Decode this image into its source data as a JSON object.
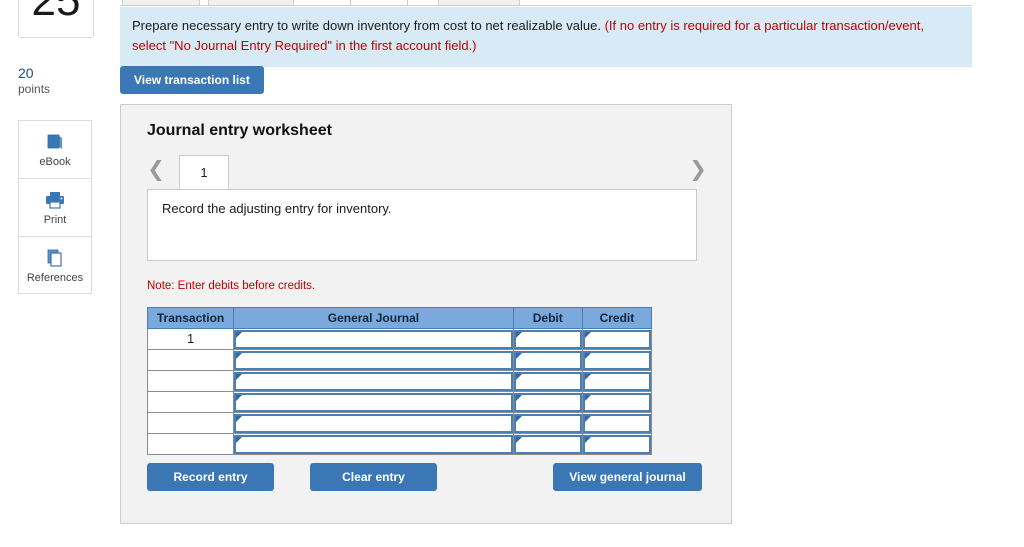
{
  "left_rail": {
    "score_box_number": "25",
    "points_value": "20",
    "points_label": "points",
    "tools": [
      {
        "label": "eBook",
        "icon": "book-icon"
      },
      {
        "label": "Print",
        "icon": "printer-icon"
      },
      {
        "label": "References",
        "icon": "copy-pages-icon"
      }
    ]
  },
  "instruction": {
    "main_text": "Prepare necessary entry to write down inventory from cost to net realizable value.",
    "hint_text": "(If no entry is required for a particular transaction/event, select \"No Journal Entry Required\" in the first account field.)"
  },
  "toolbar": {
    "view_transaction_list_label": "View transaction list"
  },
  "worksheet": {
    "title": "Journal entry worksheet",
    "pager": {
      "prev_icon": "chevron-left-icon",
      "next_icon": "chevron-right-icon",
      "current_page": "1"
    },
    "description": "Record the adjusting entry for inventory.",
    "note": "Note: Enter debits before credits.",
    "table": {
      "headers": [
        "Transaction",
        "General Journal",
        "Debit",
        "Credit"
      ],
      "rows": [
        {
          "transaction": "1",
          "general_journal": "",
          "debit": "",
          "credit": ""
        },
        {
          "transaction": "",
          "general_journal": "",
          "debit": "",
          "credit": ""
        },
        {
          "transaction": "",
          "general_journal": "",
          "debit": "",
          "credit": ""
        },
        {
          "transaction": "",
          "general_journal": "",
          "debit": "",
          "credit": ""
        },
        {
          "transaction": "",
          "general_journal": "",
          "debit": "",
          "credit": ""
        },
        {
          "transaction": "",
          "general_journal": "",
          "debit": "",
          "credit": ""
        }
      ]
    },
    "actions": {
      "record_label": "Record entry",
      "clear_label": "Clear entry",
      "view_general_journal_label": "View general journal"
    }
  },
  "colors": {
    "button_blue": "#3b77b5",
    "table_header_blue": "#7aaadd",
    "banner_blue": "#d9eaf7",
    "note_red": "#c00000",
    "points_blue": "#1f4e79"
  }
}
